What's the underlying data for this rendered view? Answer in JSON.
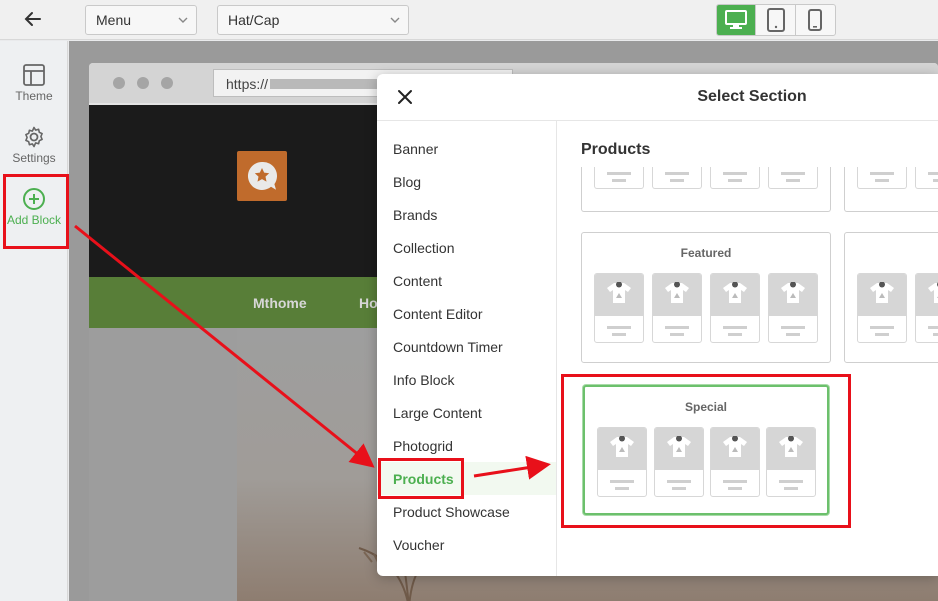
{
  "toolbar": {
    "menu_select": "Menu",
    "page_select": "Hat/Cap",
    "devices": [
      "desktop-icon",
      "tablet-icon",
      "mobile-icon"
    ],
    "active_device": "desktop"
  },
  "sidebar": {
    "items": [
      {
        "label": "Theme",
        "icon": "layout-icon"
      },
      {
        "label": "Settings",
        "icon": "gear-icon"
      },
      {
        "label": "Add Block",
        "icon": "plus-circle-icon"
      }
    ]
  },
  "preview": {
    "url_prefix": "https://",
    "nav": [
      "Mthome",
      "Ho"
    ]
  },
  "modal": {
    "title": "Select Section",
    "categories": [
      "Banner",
      "Blog",
      "Brands",
      "Collection",
      "Content",
      "Content Editor",
      "Countdown Timer",
      "Info Block",
      "Large Content",
      "Photogrid",
      "Products",
      "Product Showcase",
      "Voucher"
    ],
    "active_category": "Products",
    "pane_title": "Products",
    "cards": [
      {
        "label": ""
      },
      {
        "label": ""
      },
      {
        "label": "Featured"
      },
      {
        "label": ""
      },
      {
        "label": "Special"
      }
    ]
  },
  "colors": {
    "accent": "#4caf50",
    "annotation": "#e8101a",
    "site_nav": "#587e38",
    "logo": "#c06b2c"
  }
}
